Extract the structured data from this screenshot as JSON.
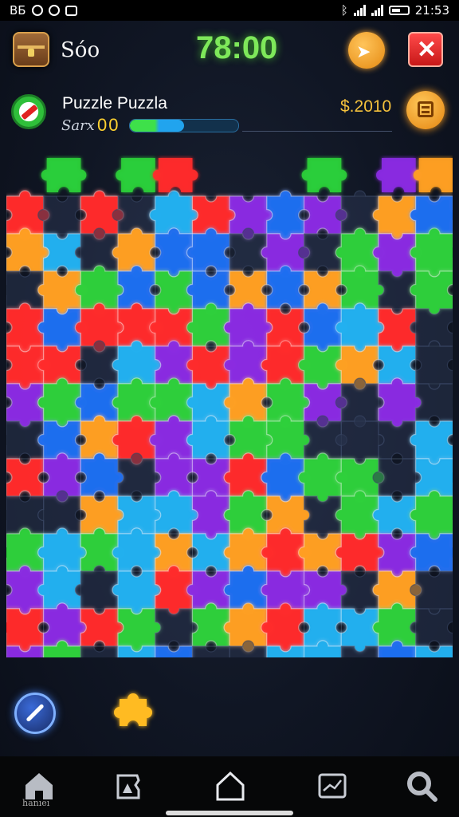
{
  "status_bar": {
    "left_text": "ВБ",
    "time": "21:53"
  },
  "top_bar": {
    "level_label": "Sóo",
    "timer": "78:00",
    "hint_icon": "hint-arrow-icon",
    "close_icon": "close-icon"
  },
  "info": {
    "puzzle_name": "Puzzle Puzzla",
    "score_label": "Sarx",
    "score_value": "00",
    "progress": 0.5,
    "money": "$.2010",
    "menu_icon": "menu-icon"
  },
  "board": {
    "colors": [
      "#2ccf3a",
      "#8a2be2",
      "#1e6ff0",
      "#ff2a2a",
      "#ffa020",
      "#1fb0f0",
      "#2a3550"
    ],
    "grid_color": "#8aa0b8"
  },
  "tools": {
    "wand_icon": "magic-wand-icon",
    "spare_piece_color": "#ffbb22"
  },
  "nav": {
    "home_label": "hanıeı",
    "items": [
      "home-icon",
      "gallery-icon",
      "shop-icon",
      "stats-icon",
      "search-icon"
    ]
  }
}
